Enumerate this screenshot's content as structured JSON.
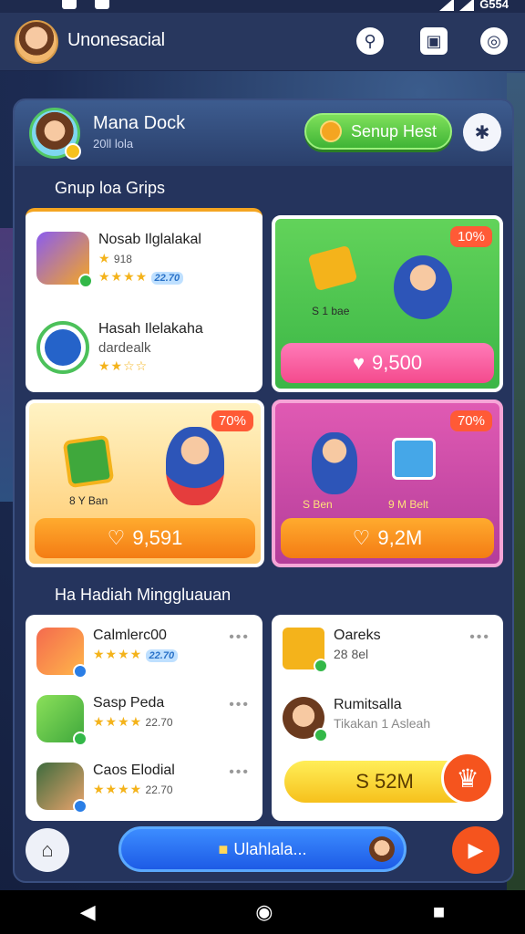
{
  "status_bar": {
    "time": "G554"
  },
  "header": {
    "title": "Unonesacial"
  },
  "user": {
    "name": "Mana Dock",
    "subtitle": "20ll lola",
    "setup_label": "Senup Hest"
  },
  "section1": {
    "title": "Gnup loa Grips",
    "list": [
      {
        "name": "Nosab Ilglalakal",
        "line2": "918",
        "score": "22.70"
      },
      {
        "name": "Hasah Ilelakaha",
        "line2": "dardealk",
        "score": ""
      }
    ],
    "promos": [
      {
        "tag": "10%",
        "caption": "S 1 bae",
        "price": "9,500"
      },
      {
        "tag": "70%",
        "caption": "8 Y Ban",
        "price": "9,591"
      },
      {
        "tag": "70%",
        "caption_left": "S Ben",
        "caption_right": "9 M Belt",
        "price": "9,2M"
      }
    ]
  },
  "section2": {
    "title": "Ha Hadiah Minggluauan",
    "left_list": [
      {
        "name": "Calmlerc00",
        "score": "22.70"
      },
      {
        "name": "Sasp Peda",
        "score": "22.70"
      },
      {
        "name": "Caos Elodial",
        "score": "22.70"
      }
    ],
    "right_list": [
      {
        "name": "Oareks",
        "meta": "28 8el"
      },
      {
        "name": "Rumitsalla",
        "meta": "Tikakan 1 Asleah"
      }
    ],
    "claim_label": "S 52M"
  },
  "bottom": {
    "cta_label": "Ulahlala..."
  },
  "colors": {
    "accent_green": "#3fb435",
    "accent_orange": "#f5541e",
    "accent_blue": "#1d5be6"
  }
}
